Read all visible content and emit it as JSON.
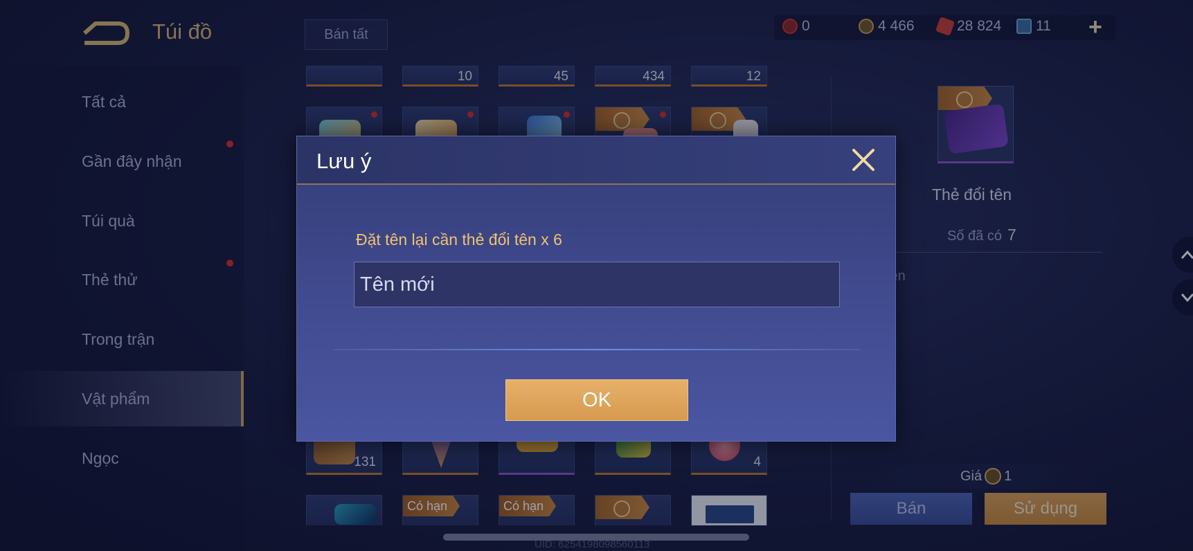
{
  "header": {
    "title": "Túi đồ",
    "sell_all_label": "Bán tất",
    "currencies": [
      {
        "icon": "voucher-icon",
        "value": "0",
        "color": "#d2332f"
      },
      {
        "icon": "gold-coin-icon",
        "value": "4 466",
        "color": "#c9a45a"
      },
      {
        "icon": "ruby-icon",
        "value": "28 824",
        "color": "#c8413b"
      },
      {
        "icon": "card-ticket-icon",
        "value": "11",
        "color": "#6aa7d8"
      }
    ]
  },
  "sidebar": {
    "items": [
      {
        "label": "Tất cả"
      },
      {
        "label": "Gần đây nhận"
      },
      {
        "label": "Túi quà"
      },
      {
        "label": "Thẻ thử"
      },
      {
        "label": "Trong trận"
      },
      {
        "label": "Vật phẩm",
        "active": true
      },
      {
        "label": "Ngọc"
      }
    ]
  },
  "grid": {
    "top_counts": [
      "10",
      "45",
      "434",
      "12"
    ],
    "bottom_counts": [
      "131",
      "4"
    ],
    "limited_tag": "Có hạn"
  },
  "detail": {
    "name": "Thẻ đổi tên",
    "owned_label": "Số đã có",
    "owned_value": "7",
    "desc_partial": "i tên",
    "price_label": "Giá",
    "price_value": "1",
    "sell_label": "Bán",
    "use_label": "Sử dụng"
  },
  "footer": {
    "uid": "UID: 6254198098560113"
  },
  "modal": {
    "title": "Lưu ý",
    "prompt": "Đặt tên lại cần thẻ đổi tên x 6",
    "input_placeholder": "Tên mới",
    "input_value": "",
    "ok_label": "OK"
  }
}
